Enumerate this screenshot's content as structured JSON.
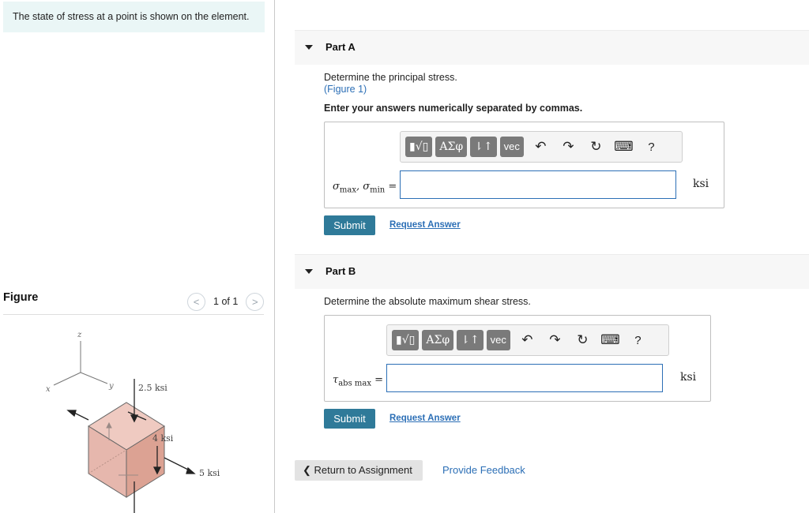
{
  "problem": {
    "text": "The state of stress at a point is shown on the element."
  },
  "figure": {
    "label": "Figure",
    "pager": {
      "prev_icon": "chevron-left-icon",
      "next_icon": "chevron-right-icon",
      "current": "1",
      "of_label": "of",
      "total": "1"
    },
    "axis_labels": {
      "z": "z",
      "y": "y",
      "x": "x"
    },
    "stress_labels": {
      "top": "2.5 ksi",
      "side": "4 ksi",
      "right": "5 ksi"
    },
    "colors": {
      "cube_face": "#e6b7ad",
      "cube_top": "#efcac1",
      "cube_right": "#dca293"
    }
  },
  "parts": [
    {
      "title": "Part A",
      "prompt": "Determine the principal stress.",
      "figure_link": "(Figure 1)",
      "instruction": "Enter your answers numerically separated by commas.",
      "toolbar": {
        "templates_label": "▮√▯",
        "greek_label": "ΑΣφ",
        "arrows_label": "⇂↑",
        "vec_label": "vec",
        "icons": [
          "undo-icon",
          "redo-icon",
          "reset-icon",
          "keyboard-icon",
          "help-icon"
        ],
        "help_label": "?"
      },
      "var_main_1": "σ",
      "var_sub_1": "max",
      "var_sep": ", ",
      "var_main_2": "σ",
      "var_sub_2": "min",
      "equals": "=",
      "input_value": "",
      "unit": "ksi",
      "submit_label": "Submit",
      "request_label": "Request Answer"
    },
    {
      "title": "Part B",
      "prompt": "Determine the absolute maximum shear stress.",
      "toolbar": {
        "templates_label": "▮√▯",
        "greek_label": "ΑΣφ",
        "arrows_label": "⇂↑",
        "vec_label": "vec",
        "icons": [
          "undo-icon",
          "redo-icon",
          "reset-icon",
          "keyboard-icon",
          "help-icon"
        ],
        "help_label": "?"
      },
      "var_main_1": "τ",
      "var_sub_1": "abs max",
      "equals": "=",
      "input_value": "",
      "unit": "ksi",
      "submit_label": "Submit",
      "request_label": "Request Answer"
    }
  ],
  "footer": {
    "return_icon": "chevron-left-icon",
    "return_label": "Return to Assignment",
    "feedback_label": "Provide Feedback"
  },
  "colors": {
    "accent": "#2c6fb6",
    "submit": "#2f7a99",
    "header_bg": "#f7f7f7",
    "problem_bg": "#eaf6f6"
  }
}
